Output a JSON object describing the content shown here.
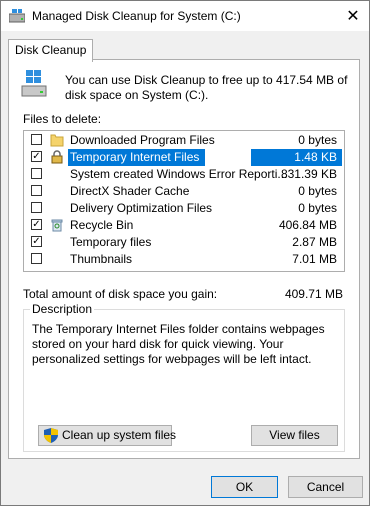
{
  "window": {
    "title": "Managed Disk Cleanup for System (C:)",
    "close_glyph": "✕"
  },
  "tabs": [
    {
      "label": "Disk Cleanup",
      "active": true
    }
  ],
  "intro_text": "You can use Disk Cleanup to free up to 417.54 MB of disk space on System (C:).",
  "files_label": "Files to delete:",
  "files": [
    {
      "name": "Downloaded Program Files",
      "size": "0 bytes",
      "checked": false,
      "selected": false,
      "icon": "folder-icon"
    },
    {
      "name": "Temporary Internet Files",
      "size": "1.48 KB",
      "checked": true,
      "selected": true,
      "icon": "lock-icon"
    },
    {
      "name": "System created Windows Error Reporti...",
      "size": "831.39 KB",
      "checked": false,
      "selected": false,
      "icon": "blank-file-icon"
    },
    {
      "name": "DirectX Shader Cache",
      "size": "0 bytes",
      "checked": false,
      "selected": false,
      "icon": "blank-file-icon"
    },
    {
      "name": "Delivery Optimization Files",
      "size": "0 bytes",
      "checked": false,
      "selected": false,
      "icon": "blank-file-icon"
    },
    {
      "name": "Recycle Bin",
      "size": "406.84 MB",
      "checked": true,
      "selected": false,
      "icon": "recycle-bin-icon"
    },
    {
      "name": "Temporary files",
      "size": "2.87 MB",
      "checked": true,
      "selected": false,
      "icon": "blank-file-icon"
    },
    {
      "name": "Thumbnails",
      "size": "7.01 MB",
      "checked": false,
      "selected": false,
      "icon": "blank-file-icon"
    }
  ],
  "total_label": "Total amount of disk space you gain:",
  "total_value": "409.71 MB",
  "description": {
    "title": "Description",
    "text": "The Temporary Internet Files folder contains webpages stored on your hard disk for quick viewing. Your personalized settings for webpages will be left intact."
  },
  "buttons": {
    "cleanup": "Clean up system files",
    "view": "View files",
    "ok": "OK",
    "cancel": "Cancel"
  },
  "colors": {
    "selection": "#0078d7",
    "default_button_border": "#0078d7"
  }
}
